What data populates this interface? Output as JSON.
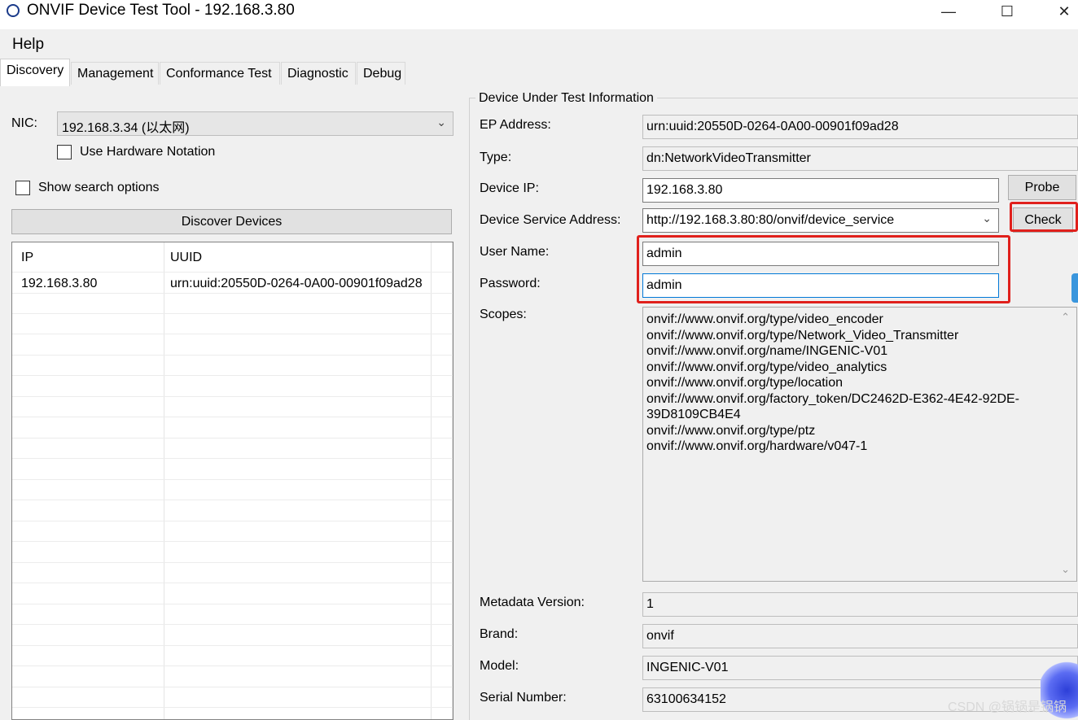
{
  "window": {
    "title": "ONVIF Device Test Tool - 192.168.3.80",
    "icon": "onvif-circle-icon"
  },
  "menu": {
    "help": "Help"
  },
  "tabs": [
    "Discovery",
    "Management",
    "Conformance Test",
    "Diagnostic",
    "Debug"
  ],
  "active_tab": "Discovery",
  "discovery": {
    "nic_label": "NIC:",
    "nic_value": "192.168.3.34 (以太网)",
    "hardware_notation": "Use Hardware Notation",
    "search_options": "Show search options",
    "discover_button": "Discover Devices",
    "columns": [
      "IP",
      "UUID"
    ],
    "devices": [
      {
        "ip": "192.168.3.80",
        "uuid": "urn:uuid:20550D-0264-0A00-00901f09ad28"
      }
    ]
  },
  "dut": {
    "group_title": "Device Under Test Information",
    "ep_address_label": "EP Address:",
    "ep_address": "urn:uuid:20550D-0264-0A00-00901f09ad28",
    "type_label": "Type:",
    "type": "dn:NetworkVideoTransmitter",
    "device_ip_label": "Device IP:",
    "device_ip": "192.168.3.80",
    "probe_button": "Probe",
    "service_address_label": "Device Service Address:",
    "service_address": "http://192.168.3.80:80/onvif/device_service",
    "check_button": "Check",
    "username_label": "User Name:",
    "username": "admin",
    "password_label": "Password:",
    "password": "admin",
    "scopes_label": "Scopes:",
    "scopes": [
      "onvif://www.onvif.org/type/video_encoder",
      "onvif://www.onvif.org/type/Network_Video_Transmitter",
      "onvif://www.onvif.org/name/INGENIC-V01",
      "onvif://www.onvif.org/type/video_analytics",
      "onvif://www.onvif.org/type/location",
      "onvif://www.onvif.org/factory_token/DC2462D-E362-4E42-92DE-",
      "39D8109CB4E4",
      "onvif://www.onvif.org/type/ptz",
      "onvif://www.onvif.org/hardware/v047-1"
    ],
    "metadata_version_label": "Metadata Version:",
    "metadata_version": "1",
    "brand_label": "Brand:",
    "brand": "onvif",
    "model_label": "Model:",
    "model": "INGENIC-V01",
    "serial_label": "Serial Number:",
    "serial": "63100634152"
  },
  "watermark": "CSDN @锅锅是锅锅",
  "colors": {
    "highlight": "#e0201c",
    "focus": "#0078d7"
  }
}
